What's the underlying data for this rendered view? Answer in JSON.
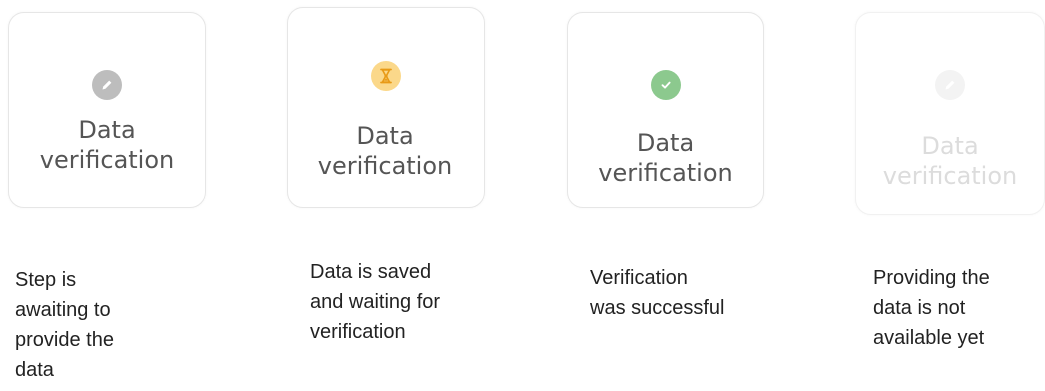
{
  "steps": [
    {
      "label": "Data\nverification",
      "icon": "pencil-icon",
      "icon_color": "#bdbdbd",
      "status": "awaiting",
      "caption": "Step is\nawaiting to\nprovide the\ndata"
    },
    {
      "label": "Data\nverification",
      "icon": "hourglass-icon",
      "icon_color": "#fbd88a",
      "status": "pending",
      "caption": "Data is saved\nand waiting for\nverification"
    },
    {
      "label": "Data\nverification",
      "icon": "checkmark-icon",
      "icon_color": "#8cc98e",
      "status": "success",
      "caption": "Verification\nwas successful"
    },
    {
      "label": "Data\nverification",
      "icon": "pencil-icon",
      "icon_color": "#f3f3f3",
      "status": "disabled",
      "caption": "Providing the\ndata is not\navailable yet"
    }
  ]
}
